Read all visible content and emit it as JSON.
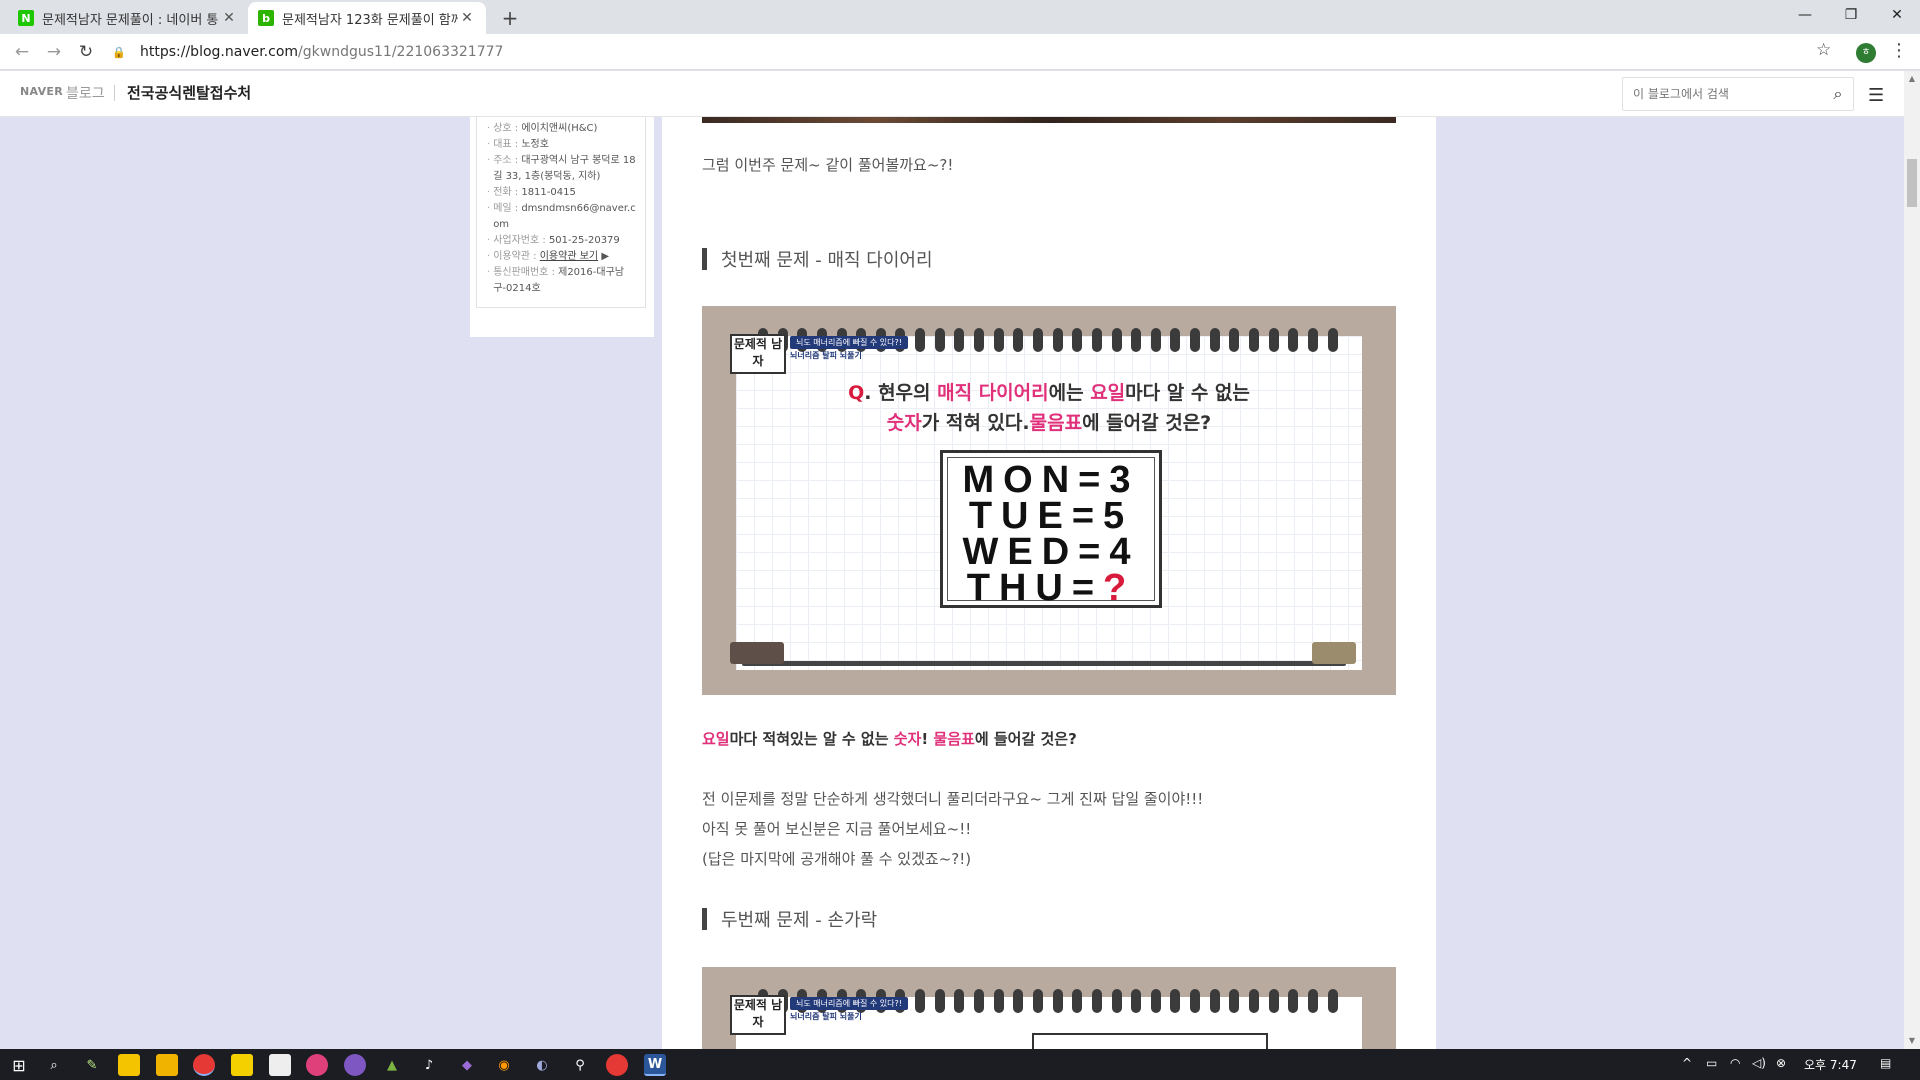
{
  "browser": {
    "tabs": [
      {
        "title": "문제적남자 문제풀이 : 네이버 통",
        "favicon": "N"
      },
      {
        "title": "문제적남자 123화 문제풀이 함께",
        "favicon": "blog"
      }
    ],
    "url_host": "https://blog.naver.com",
    "url_path": "/gkwndgus11/221063321777",
    "profile_initial": "ㅎ"
  },
  "blog_header": {
    "naver_label": "NAVER",
    "blog_label": "블로그",
    "blog_name": "전국공식렌탈접수처",
    "search_placeholder": "이 블로그에서 검색"
  },
  "sidebar_info": [
    {
      "key": "상호 :",
      "value": "에이치앤씨(H&C)"
    },
    {
      "key": "대표 :",
      "value": "노정호"
    },
    {
      "key": "주소 :",
      "value": "대구광역시 남구 봉덕로 18길 33, 1층(봉덕동, 지하)"
    },
    {
      "key": "전화 :",
      "value": "1811-0415"
    },
    {
      "key": "메일 :",
      "value": "dmsndmsn66@naver.com"
    },
    {
      "key": "사업자번호 :",
      "value": "501-25-20379"
    },
    {
      "key": "이용약관 :",
      "value": "이용약관 보기"
    },
    {
      "key": "통신판매번호 :",
      "value": "제2016-대구남구-0214호"
    }
  ],
  "post": {
    "intro": "그럼 이번주 문제~ 같이 풀어볼까요~?!",
    "heading1": "첫번째 문제 - 매직 다이어리",
    "image1": {
      "show_logo": "문제적 남자",
      "badge": "뇌도 매너리즘에 빠질 수 있다?!",
      "sub": "뇌너리즘 탈피 뇌풀기",
      "q_prefix": "Q",
      "q_line1_a": ". 현우의 ",
      "q_line1_b": "매직 다이어리",
      "q_line1_c": "에는 ",
      "q_line1_d": "요일",
      "q_line1_e": "마다 알 수 없는",
      "q_line2_a": "숫자",
      "q_line2_b": "가 적혀 있다.",
      "q_line2_c": "물음표",
      "q_line2_d": "에 들어갈 것은?",
      "rows": [
        {
          "text": "MON=3",
          "prefix": "MON=",
          "answer": "3"
        },
        {
          "text": "TUE=5",
          "prefix": "TUE=",
          "answer": "5"
        },
        {
          "text": "WED=4",
          "prefix": "WED=",
          "answer": "4"
        },
        {
          "text": "THU=?",
          "prefix": "THU=",
          "answer": "?"
        }
      ]
    },
    "caption": {
      "a": "요일",
      "b": "마다 적혀있는 알 수 없는 ",
      "c": "숫자",
      "d": "! ",
      "e": "물음표",
      "f": "에 들어갈 것은?"
    },
    "para1": "전 이문제를 정말 단순하게 생각했더니 풀리더라구요~ 그게 진짜 답일 줄이야!!!",
    "para2": "아직 못 풀어 보신분은 지금 풀어보세요~!!",
    "para3": "(답은 마지막에 공개해야 풀 수 있겠죠~?!)",
    "heading2": "두번째 문제 - 손가락"
  },
  "taskbar": {
    "clock": "오후 7:47"
  },
  "colors": {
    "accent_pink": "#e0307a",
    "question_red": "#d81a3c",
    "page_bg": "#dfe1f2"
  }
}
